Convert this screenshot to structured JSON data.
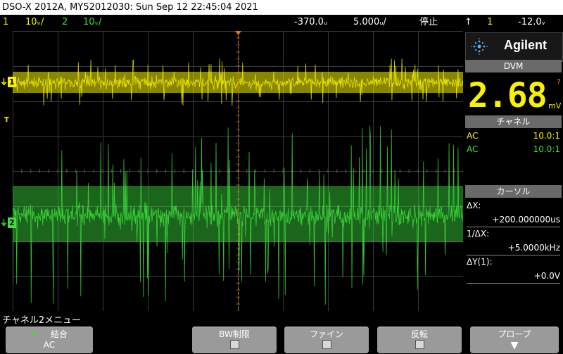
{
  "title_bar": {
    "text": "DSO-X 2012A, MY52012030: Sun Sep 12 22:45:04 2021"
  },
  "status_bar": {
    "ch1": {
      "num": "1",
      "scale": "10ᵥ/"
    },
    "ch2": {
      "num": "2",
      "scale": "10ᵥ/"
    },
    "time_delay": "-370.0ᵤ",
    "time_scale": "5.000ᵤ/",
    "run_state": "停止",
    "trigger": {
      "slope": "↑",
      "source": "1",
      "level": "-12.0ᵥ"
    }
  },
  "graticule": {
    "ch1_marker": "1",
    "ch2_marker": "2",
    "trigger_marker": "T"
  },
  "right_panel": {
    "brand": "Agilent",
    "dvm": {
      "header": "DVM",
      "value": "2.68",
      "unit": "mV",
      "flag": "?"
    },
    "channel": {
      "header": "チャネル",
      "rows": [
        {
          "coupling": "AC",
          "probe": "10.0:1",
          "color": "#f7f200"
        },
        {
          "coupling": "AC",
          "probe": "10.0:1",
          "color": "#3fe03f"
        }
      ]
    },
    "cursors": {
      "header": "カーソル",
      "dx_label": "ΔX:",
      "dx_value": "+200.000000us",
      "inv_dx_label": "1/ΔX:",
      "inv_dx_value": "+5.0000kHz",
      "dy_label": "ΔY(1):",
      "dy_value": "+0.0V"
    }
  },
  "menu": {
    "title": "チャネル2メニュー",
    "softkeys": [
      {
        "label": "結合",
        "value": "AC"
      },
      {
        "label": "BW制限"
      },
      {
        "label": "ファイン"
      },
      {
        "label": "反転"
      },
      {
        "label": "プローブ"
      }
    ]
  },
  "colors": {
    "ch1": "#f7f200",
    "ch2": "#3fe03f",
    "trigger": "#e87a00",
    "grid": "#3a3a3a"
  }
}
